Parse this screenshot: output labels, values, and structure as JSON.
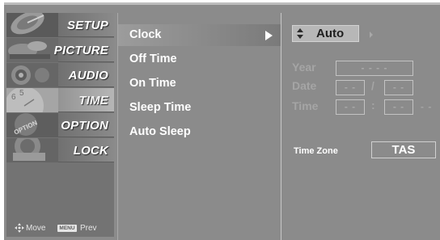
{
  "sidebar": {
    "items": [
      {
        "label": "SETUP",
        "icon": "satellite-dish-icon",
        "active": false
      },
      {
        "label": "PICTURE",
        "icon": "picture-icon",
        "active": false
      },
      {
        "label": "AUDIO",
        "icon": "speaker-icon",
        "active": false
      },
      {
        "label": "TIME",
        "icon": "clock-icon",
        "active": true
      },
      {
        "label": "OPTION",
        "icon": "option-icon",
        "active": false
      },
      {
        "label": "LOCK",
        "icon": "lock-icon",
        "active": false
      }
    ],
    "help": {
      "move_label": "Move",
      "menu_key": "MENU",
      "prev_label": "Prev"
    }
  },
  "submenu": {
    "items": [
      {
        "label": "Clock",
        "selected": true
      },
      {
        "label": "Off Time",
        "selected": false
      },
      {
        "label": "On Time",
        "selected": false
      },
      {
        "label": "Sleep Time",
        "selected": false
      },
      {
        "label": "Auto Sleep",
        "selected": false
      }
    ]
  },
  "panel": {
    "mode_value": "Auto",
    "year": {
      "label": "Year",
      "value": "- - - -"
    },
    "date": {
      "label": "Date",
      "month": "- -",
      "separator": "/",
      "day": "- -"
    },
    "time": {
      "label": "Time",
      "hour": "- -",
      "separator": ":",
      "minute": "- -",
      "trailing": "- -"
    },
    "time_zone": {
      "label": "Time Zone",
      "value": "TAS"
    }
  },
  "colors": {
    "background": "#8b8b8b",
    "highlight": "#b7b7b7",
    "text": "#ffffff",
    "disabled_text": "#a5a5a5"
  }
}
